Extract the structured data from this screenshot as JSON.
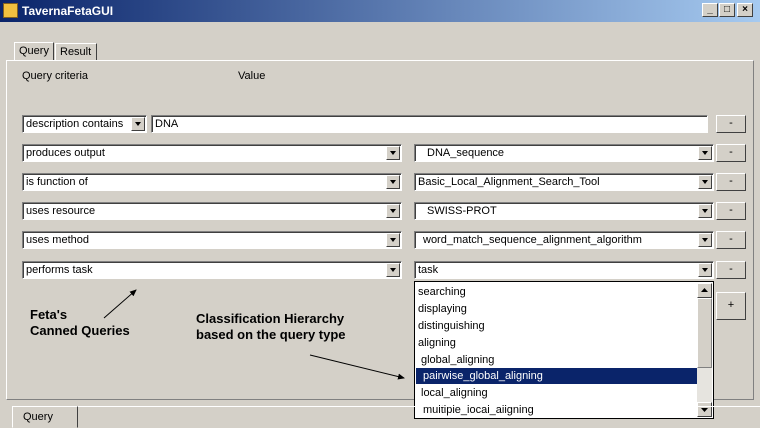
{
  "window": {
    "title": "TavernaFetaGUI",
    "minimize": "_",
    "maximize": "□",
    "close": "×"
  },
  "tabs": [
    "Query",
    "Result"
  ],
  "header": {
    "criteria": "Query criteria",
    "value": "Value"
  },
  "rows": [
    {
      "criterion": "description contains",
      "value": "DNA",
      "button": "-"
    },
    {
      "criterion": "produces output",
      "value": "DNA_sequence",
      "button": "-"
    },
    {
      "criterion": "is function of",
      "value": "Basic_Local_Alignment_Search_Tool",
      "button": "-"
    },
    {
      "criterion": "uses resource",
      "value": "SWISS-PROT",
      "button": "-"
    },
    {
      "criterion": "uses method",
      "value": "word_match_sequence_alignment_algorithm",
      "button": "-"
    },
    {
      "criterion": "performs task",
      "value": "task",
      "button": "-"
    }
  ],
  "add_button": "+",
  "dropdown_list": {
    "items": [
      "searching",
      "displaying",
      "distinguishing",
      "aligning",
      "global_aligning",
      "pairwise_global_aligning",
      "local_aligning",
      "multiple_local_aligning"
    ],
    "selected_index": 5
  },
  "annotations": {
    "canned_line1": "Feta's",
    "canned_line2": "Canned Queries",
    "hierarchy_line1": "Classification Hierarchy",
    "hierarchy_line2": "based on the query  type"
  },
  "bottom_tab": "Query",
  "colors": {
    "title_bar": "#0a246a",
    "selection": "#0a246a",
    "face": "#d4d0c8"
  }
}
